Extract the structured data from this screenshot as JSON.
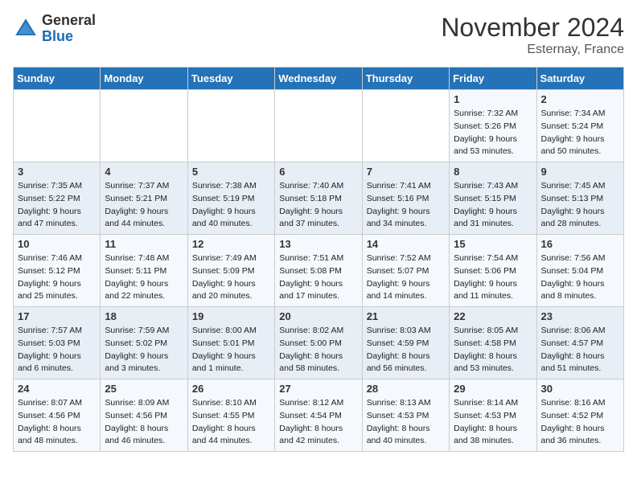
{
  "header": {
    "logo_line1": "General",
    "logo_line2": "Blue",
    "month": "November 2024",
    "location": "Esternay, France"
  },
  "weekdays": [
    "Sunday",
    "Monday",
    "Tuesday",
    "Wednesday",
    "Thursday",
    "Friday",
    "Saturday"
  ],
  "weeks": [
    [
      {
        "day": "",
        "info": ""
      },
      {
        "day": "",
        "info": ""
      },
      {
        "day": "",
        "info": ""
      },
      {
        "day": "",
        "info": ""
      },
      {
        "day": "",
        "info": ""
      },
      {
        "day": "1",
        "info": "Sunrise: 7:32 AM\nSunset: 5:26 PM\nDaylight: 9 hours\nand 53 minutes."
      },
      {
        "day": "2",
        "info": "Sunrise: 7:34 AM\nSunset: 5:24 PM\nDaylight: 9 hours\nand 50 minutes."
      }
    ],
    [
      {
        "day": "3",
        "info": "Sunrise: 7:35 AM\nSunset: 5:22 PM\nDaylight: 9 hours\nand 47 minutes."
      },
      {
        "day": "4",
        "info": "Sunrise: 7:37 AM\nSunset: 5:21 PM\nDaylight: 9 hours\nand 44 minutes."
      },
      {
        "day": "5",
        "info": "Sunrise: 7:38 AM\nSunset: 5:19 PM\nDaylight: 9 hours\nand 40 minutes."
      },
      {
        "day": "6",
        "info": "Sunrise: 7:40 AM\nSunset: 5:18 PM\nDaylight: 9 hours\nand 37 minutes."
      },
      {
        "day": "7",
        "info": "Sunrise: 7:41 AM\nSunset: 5:16 PM\nDaylight: 9 hours\nand 34 minutes."
      },
      {
        "day": "8",
        "info": "Sunrise: 7:43 AM\nSunset: 5:15 PM\nDaylight: 9 hours\nand 31 minutes."
      },
      {
        "day": "9",
        "info": "Sunrise: 7:45 AM\nSunset: 5:13 PM\nDaylight: 9 hours\nand 28 minutes."
      }
    ],
    [
      {
        "day": "10",
        "info": "Sunrise: 7:46 AM\nSunset: 5:12 PM\nDaylight: 9 hours\nand 25 minutes."
      },
      {
        "day": "11",
        "info": "Sunrise: 7:48 AM\nSunset: 5:11 PM\nDaylight: 9 hours\nand 22 minutes."
      },
      {
        "day": "12",
        "info": "Sunrise: 7:49 AM\nSunset: 5:09 PM\nDaylight: 9 hours\nand 20 minutes."
      },
      {
        "day": "13",
        "info": "Sunrise: 7:51 AM\nSunset: 5:08 PM\nDaylight: 9 hours\nand 17 minutes."
      },
      {
        "day": "14",
        "info": "Sunrise: 7:52 AM\nSunset: 5:07 PM\nDaylight: 9 hours\nand 14 minutes."
      },
      {
        "day": "15",
        "info": "Sunrise: 7:54 AM\nSunset: 5:06 PM\nDaylight: 9 hours\nand 11 minutes."
      },
      {
        "day": "16",
        "info": "Sunrise: 7:56 AM\nSunset: 5:04 PM\nDaylight: 9 hours\nand 8 minutes."
      }
    ],
    [
      {
        "day": "17",
        "info": "Sunrise: 7:57 AM\nSunset: 5:03 PM\nDaylight: 9 hours\nand 6 minutes."
      },
      {
        "day": "18",
        "info": "Sunrise: 7:59 AM\nSunset: 5:02 PM\nDaylight: 9 hours\nand 3 minutes."
      },
      {
        "day": "19",
        "info": "Sunrise: 8:00 AM\nSunset: 5:01 PM\nDaylight: 9 hours\nand 1 minute."
      },
      {
        "day": "20",
        "info": "Sunrise: 8:02 AM\nSunset: 5:00 PM\nDaylight: 8 hours\nand 58 minutes."
      },
      {
        "day": "21",
        "info": "Sunrise: 8:03 AM\nSunset: 4:59 PM\nDaylight: 8 hours\nand 56 minutes."
      },
      {
        "day": "22",
        "info": "Sunrise: 8:05 AM\nSunset: 4:58 PM\nDaylight: 8 hours\nand 53 minutes."
      },
      {
        "day": "23",
        "info": "Sunrise: 8:06 AM\nSunset: 4:57 PM\nDaylight: 8 hours\nand 51 minutes."
      }
    ],
    [
      {
        "day": "24",
        "info": "Sunrise: 8:07 AM\nSunset: 4:56 PM\nDaylight: 8 hours\nand 48 minutes."
      },
      {
        "day": "25",
        "info": "Sunrise: 8:09 AM\nSunset: 4:56 PM\nDaylight: 8 hours\nand 46 minutes."
      },
      {
        "day": "26",
        "info": "Sunrise: 8:10 AM\nSunset: 4:55 PM\nDaylight: 8 hours\nand 44 minutes."
      },
      {
        "day": "27",
        "info": "Sunrise: 8:12 AM\nSunset: 4:54 PM\nDaylight: 8 hours\nand 42 minutes."
      },
      {
        "day": "28",
        "info": "Sunrise: 8:13 AM\nSunset: 4:53 PM\nDaylight: 8 hours\nand 40 minutes."
      },
      {
        "day": "29",
        "info": "Sunrise: 8:14 AM\nSunset: 4:53 PM\nDaylight: 8 hours\nand 38 minutes."
      },
      {
        "day": "30",
        "info": "Sunrise: 8:16 AM\nSunset: 4:52 PM\nDaylight: 8 hours\nand 36 minutes."
      }
    ]
  ]
}
